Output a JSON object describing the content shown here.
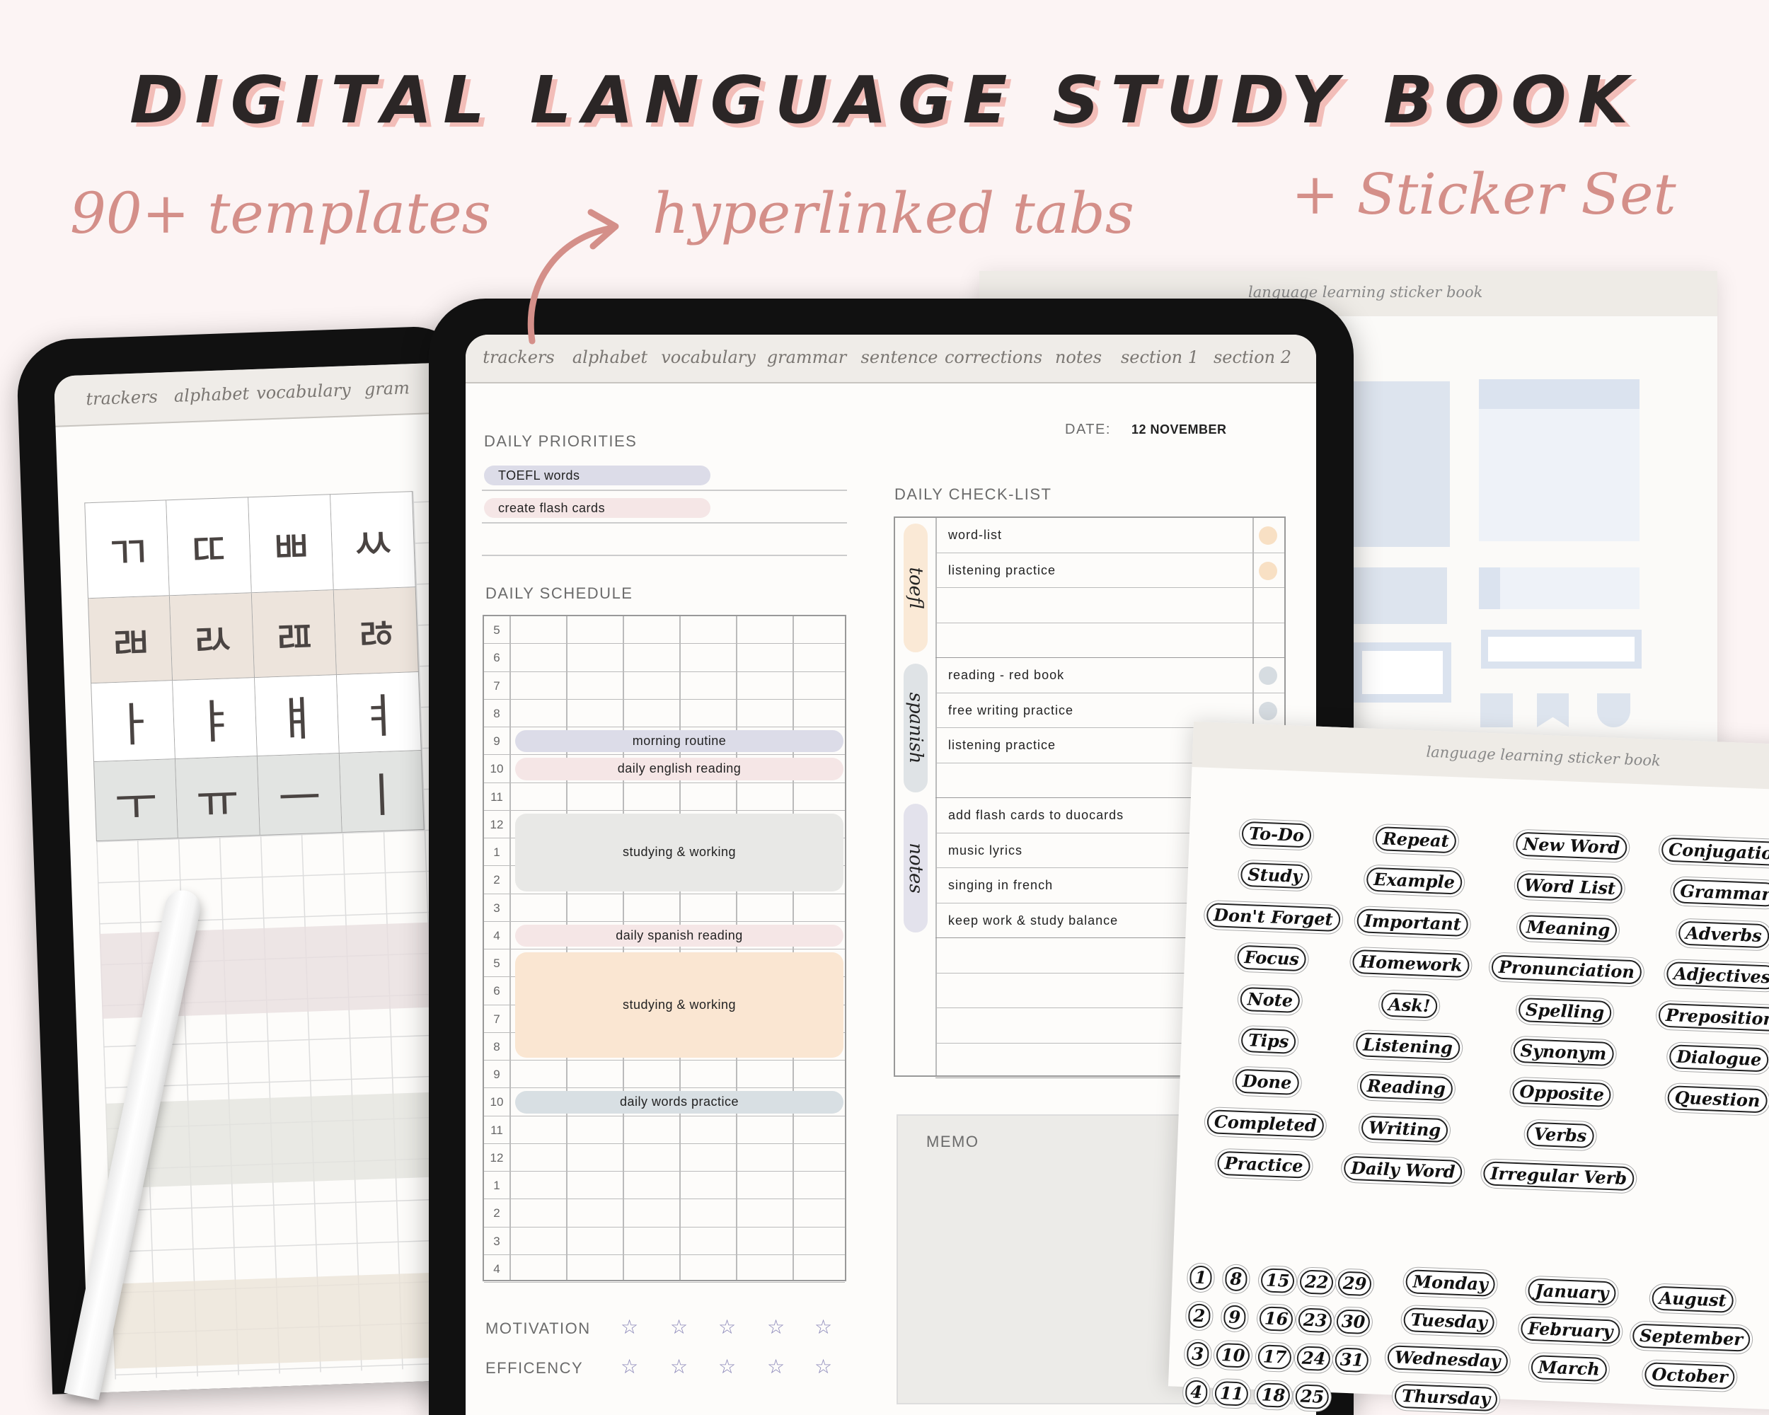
{
  "header": {
    "title": "DIGITAL LANGUAGE STUDY BOOK",
    "feature_templates": "90+ templates",
    "feature_tabs": "hyperlinked tabs",
    "feature_stickers": "+ Sticker Set"
  },
  "colors": {
    "background": "#fcf4f4",
    "accent": "#d48f89",
    "title_shadow": "#f2bdb8",
    "lavender": "#dcdce8",
    "pink": "#f5e6e6",
    "gray": "#e8e8e6",
    "peach": "#fae6d2",
    "bluegray": "#d8dfe3",
    "star": "#8a86b8"
  },
  "tabs": [
    "trackers",
    "alphabet",
    "vocabulary",
    "grammar",
    "sentence",
    "corrections",
    "notes",
    "section 1",
    "section 2"
  ],
  "left_ipad": {
    "tabs": [
      "trackers",
      "alphabet",
      "vocabulary",
      "gram"
    ],
    "hangul_rows": [
      [
        "ㄲ",
        "ㄸ",
        "ㅃ",
        "ㅆ"
      ],
      [
        "ㄼ",
        "ㄽ",
        "ㄿ",
        "ㅀ"
      ],
      [
        "ㅏ",
        "ㅑ",
        "ㅒ",
        "ㅕ"
      ],
      [
        "ㅜ",
        "ㅠ",
        "ㅡ",
        "ㅣ"
      ]
    ]
  },
  "planner": {
    "priorities_label": "DAILY PRIORITIES",
    "priorities": [
      {
        "text": "TOEFL words",
        "color": "#dcdce8"
      },
      {
        "text": "create flash cards",
        "color": "#f5e6e6"
      }
    ],
    "date_label": "DATE:",
    "date_value": "12 NOVEMBER",
    "schedule_label": "DAILY SCHEDULE",
    "hours": [
      "5",
      "6",
      "7",
      "8",
      "9",
      "10",
      "11",
      "12",
      "1",
      "2",
      "3",
      "4",
      "5",
      "6",
      "7",
      "8",
      "9",
      "10",
      "11",
      "12",
      "1",
      "2",
      "3",
      "4"
    ],
    "events": [
      {
        "label": "morning routine",
        "start": 9,
        "end": 10,
        "color": "#dcdce8"
      },
      {
        "label": "daily english reading",
        "start": 10,
        "end": 11,
        "color": "#f5e6e6"
      },
      {
        "label": "studying & working",
        "start": 12,
        "end": 15,
        "color": "#e8e8e6"
      },
      {
        "label": "daily spanish reading",
        "start": 16,
        "end": 17,
        "color": "#f5e6e6"
      },
      {
        "label": "studying & working",
        "start": 17,
        "end": 21,
        "color": "#fae6d2"
      },
      {
        "label": "daily words practice",
        "start": 22,
        "end": 23,
        "color": "#d8dfe3"
      }
    ],
    "motivation_label": "MOTIVATION",
    "efficiency_label": "EFFICENCY",
    "star_icon": "☆",
    "checklist_label": "DAILY CHECK-LIST",
    "checklist": [
      {
        "category": "toefl",
        "color": "#fae9d6",
        "items": [
          {
            "text": "word-list",
            "dot": "#f8e0c4"
          },
          {
            "text": "listening practice",
            "dot": "#f8e0c4"
          },
          {
            "text": ""
          },
          {
            "text": ""
          }
        ]
      },
      {
        "category": "spanish",
        "color": "#dfe3e6",
        "items": [
          {
            "text": "reading - red book",
            "dot": "#d6dce1"
          },
          {
            "text": "free writing practice",
            "dot": "#d6dce1"
          },
          {
            "text": "listening practice"
          },
          {
            "text": ""
          }
        ]
      },
      {
        "category": "notes",
        "color": "#e3e2ec",
        "items": [
          {
            "text": "add flash cards to duocards"
          },
          {
            "text": "music lyrics"
          },
          {
            "text": "singing in french"
          },
          {
            "text": "keep work & study balance"
          }
        ]
      },
      {
        "category": "",
        "color": "",
        "items": [
          {
            "text": ""
          },
          {
            "text": ""
          },
          {
            "text": ""
          },
          {
            "text": ""
          }
        ]
      }
    ],
    "memo_label": "MEMO"
  },
  "sticker_book": {
    "title": "language learning sticker book",
    "columns": [
      [
        "To-Do",
        "Study",
        "Don't Forget",
        "Focus",
        "Note",
        "Tips",
        "Done",
        "Completed",
        "Practice"
      ],
      [
        "Repeat",
        "Example",
        "Important",
        "Homework",
        "Ask!",
        "Listening",
        "Reading",
        "Writing",
        "Daily Word"
      ],
      [
        "New Word",
        "Word List",
        "Meaning",
        "Pronunciation",
        "Spelling",
        "Synonym",
        "Opposite",
        "Verbs",
        "Irregular Verb"
      ],
      [
        "Conjugation",
        "Grammar",
        "Adverbs",
        "Adjectives",
        "Preposition",
        "Dialogue",
        "Question"
      ]
    ],
    "numbers": [
      [
        "1",
        "8",
        "15",
        "22",
        "29"
      ],
      [
        "2",
        "9",
        "16",
        "23",
        "30"
      ],
      [
        "3",
        "10",
        "17",
        "24",
        "31"
      ],
      [
        "4",
        "11",
        "18",
        "25"
      ]
    ],
    "days": [
      "Monday",
      "Tuesday",
      "Wednesday",
      "Thursday"
    ],
    "months_a": [
      "January",
      "February",
      "March"
    ],
    "months_b": [
      "August",
      "September",
      "October"
    ]
  }
}
